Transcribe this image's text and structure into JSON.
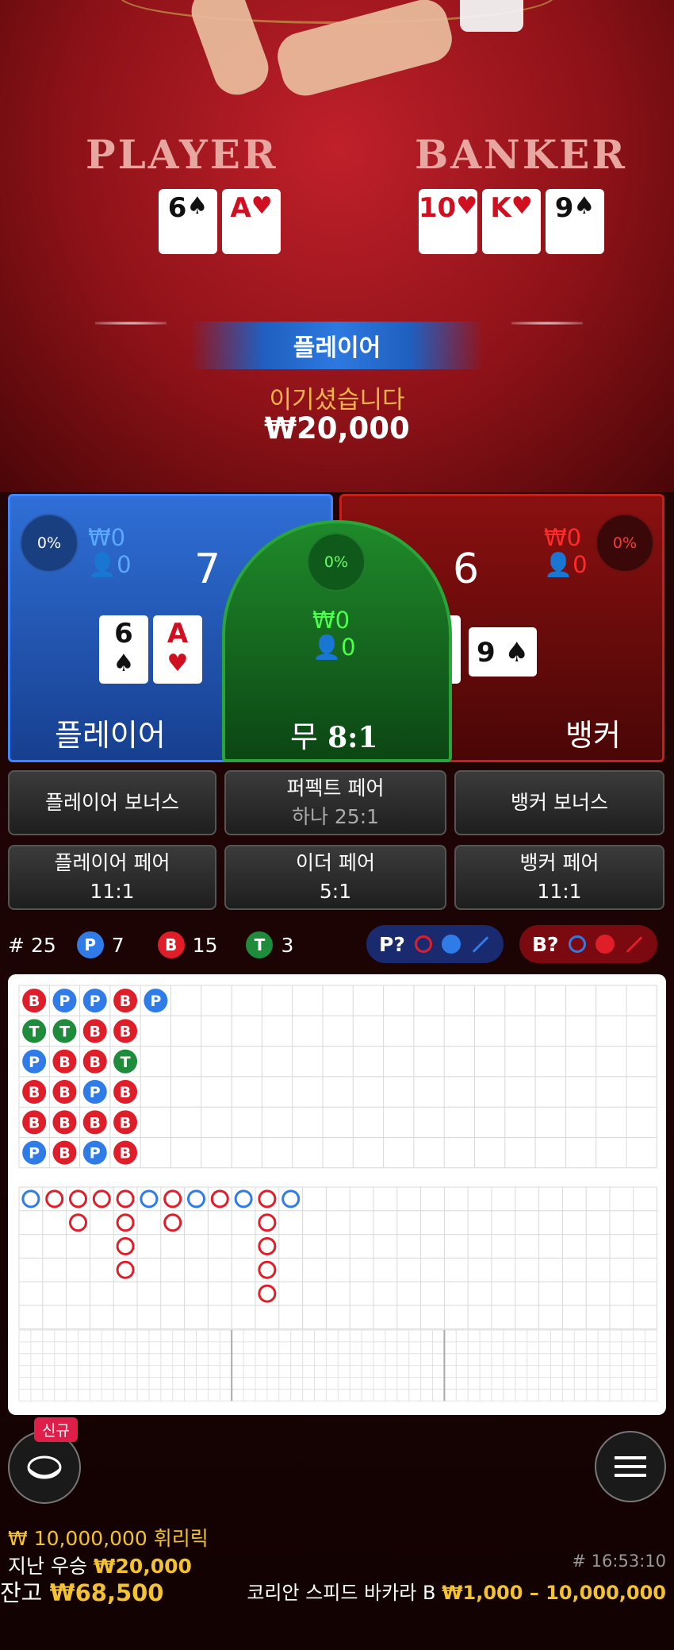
{
  "table": {
    "player_label": "PLAYER",
    "banker_label": "BANKER",
    "player_cards": [
      {
        "rank": "6",
        "suit": "♠",
        "red": false
      },
      {
        "rank": "A",
        "suit": "♥",
        "red": true
      }
    ],
    "banker_cards": [
      {
        "rank": "10",
        "suit": "♥",
        "red": true
      },
      {
        "rank": "K",
        "suit": "♥",
        "red": true
      },
      {
        "rank": "9",
        "suit": "♠",
        "red": false
      }
    ]
  },
  "result": {
    "winner": "플레이어",
    "message": "이기셨습니다",
    "amount": "₩20,000"
  },
  "bets": {
    "player": {
      "percent": "0%",
      "amount": "₩0",
      "players": "0",
      "score": "7",
      "label": "플레이어",
      "cards": [
        {
          "rank": "6",
          "suit": "♠",
          "red": false
        },
        {
          "rank": "A",
          "suit": "♥",
          "red": true
        }
      ]
    },
    "tie": {
      "percent": "0%",
      "amount": "₩0",
      "players": "0",
      "label": "무",
      "payout": "8:1"
    },
    "banker": {
      "percent": "0%",
      "amount": "₩0",
      "players": "0",
      "score": "6",
      "label": "뱅커",
      "cards": [
        {
          "rank": "10",
          "suit": "♥",
          "red": true
        },
        {
          "rank": "K",
          "suit": "♥",
          "red": true
        },
        {
          "rank": "9",
          "suit": "♠",
          "red": false
        }
      ]
    }
  },
  "side_bets": {
    "player_bonus": "플레이어 보너스",
    "perfect_pair": "퍼펙트 페어",
    "perfect_pair_odds": "하나 25:1",
    "banker_bonus": "뱅커 보너스",
    "player_pair": "플레이어 페어",
    "player_pair_odds": "11:1",
    "either_pair": "이더 페어",
    "either_pair_odds": "5:1",
    "banker_pair": "뱅커 페어",
    "banker_pair_odds": "11:1"
  },
  "stats": {
    "rounds_label": "#",
    "rounds": "25",
    "p_letter": "P",
    "p_count": "7",
    "b_letter": "B",
    "b_count": "15",
    "t_letter": "T",
    "t_count": "3"
  },
  "predictions": {
    "player": "P?",
    "banker": "B?"
  },
  "colors": {
    "player": "#2f7be8",
    "banker": "#e01e2a",
    "tie": "#1e8c3a",
    "accent": "#f2c230"
  },
  "bead_road": [
    [
      "B",
      "T",
      "P",
      "B",
      "B",
      "P"
    ],
    [
      "P",
      "T",
      "B",
      "B",
      "B",
      "B"
    ],
    [
      "P",
      "B",
      "B",
      "P",
      "B",
      "P"
    ],
    [
      "B",
      "B",
      "T",
      "B",
      "B",
      "B"
    ],
    [
      "P"
    ]
  ],
  "big_road": [
    [
      "P"
    ],
    [
      "B"
    ],
    [
      "B",
      "B"
    ],
    [
      "B"
    ],
    [
      "B",
      "B",
      "B",
      "B"
    ],
    [
      "P"
    ],
    [
      "B",
      "B"
    ],
    [
      "P"
    ],
    [
      "B"
    ],
    [
      "P"
    ],
    [
      "B",
      "B",
      "B",
      "B",
      "B"
    ],
    [
      "P"
    ]
  ],
  "bottom": {
    "new_badge": "신규",
    "jackpot": "₩ 10,000,000 휘리릭",
    "last_win_label": "지난 우승",
    "last_win_amount": "₩20,000",
    "round_id": "# 16:53:10",
    "balance_label": "잔고",
    "balance_amount": "₩68,500",
    "table_name": "코리안 스피드 바카라 B",
    "limits": "₩1,000 – 10,000,000"
  }
}
